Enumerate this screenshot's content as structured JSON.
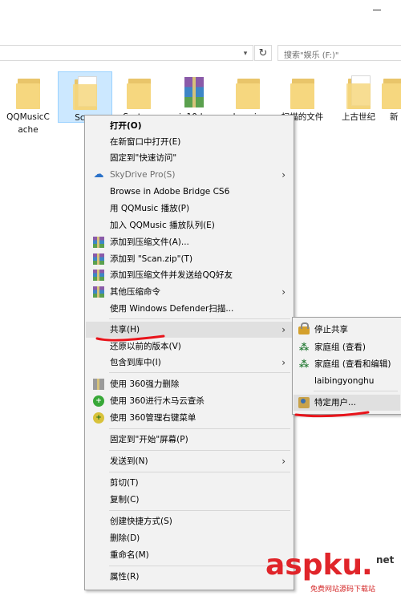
{
  "toolbar": {
    "refresh_icon": "↻",
    "search_placeholder": "搜索\"娱乐 (F:)\""
  },
  "files": [
    {
      "name": "QQMusicC ache",
      "icon": "folder"
    },
    {
      "name": "Scan",
      "icon": "folder-doc",
      "selected": true
    },
    {
      "name": "System",
      "icon": "folder"
    },
    {
      "name": "win10dow",
      "icon": "zip"
    },
    {
      "name": "zhaopian",
      "icon": "folder"
    },
    {
      "name": "扫描的文件",
      "icon": "folder"
    },
    {
      "name": "上古世纪",
      "icon": "folder-doc"
    },
    {
      "name": "新",
      "icon": "folder"
    }
  ],
  "context_menu": {
    "items": [
      {
        "label": "打开(O)",
        "bold": true
      },
      {
        "label": "在新窗口中打开(E)"
      },
      {
        "label": "固定到\"快速访问\""
      },
      {
        "label": "SkyDrive Pro(S)",
        "icon": "skydrive-icon",
        "disabled": true,
        "submenu": true
      },
      {
        "label": "Browse in Adobe Bridge CS6"
      },
      {
        "label": "用 QQMusic 播放(P)"
      },
      {
        "label": "加入 QQMusic 播放队列(E)"
      },
      {
        "label": "添加到压缩文件(A)...",
        "icon": "winrar-icon"
      },
      {
        "label": "添加到 \"Scan.zip\"(T)",
        "icon": "winrar-icon"
      },
      {
        "label": "添加到压缩文件并发送给QQ好友",
        "icon": "winrar-icon"
      },
      {
        "label": "其他压缩命令",
        "icon": "winrar-icon",
        "submenu": true
      },
      {
        "label": "使用 Windows Defender扫描..."
      },
      {
        "label": "共享(H)",
        "submenu": true,
        "highlighted": true
      },
      {
        "label": "还原以前的版本(V)"
      },
      {
        "label": "包含到库中(I)",
        "submenu": true
      },
      {
        "label": "使用 360强力删除",
        "icon": "shred-icon"
      },
      {
        "label": "使用 360进行木马云查杀",
        "icon": "360-scan-icon"
      },
      {
        "label": "使用 360管理右键菜单",
        "icon": "360-scan-icon"
      },
      {
        "label": "固定到\"开始\"屏幕(P)"
      },
      {
        "label": "发送到(N)",
        "submenu": true
      },
      {
        "label": "剪切(T)"
      },
      {
        "label": "复制(C)"
      },
      {
        "label": "创建快捷方式(S)"
      },
      {
        "label": "删除(D)"
      },
      {
        "label": "重命名(M)"
      },
      {
        "label": "属性(R)"
      }
    ]
  },
  "share_submenu": {
    "items": [
      {
        "label": "停止共享",
        "icon": "lock-icon"
      },
      {
        "label": "家庭组 (查看)",
        "icon": "homegroup-icon"
      },
      {
        "label": "家庭组 (查看和编辑)",
        "icon": "homegroup-icon"
      },
      {
        "label": "laibingyonghu"
      },
      {
        "label": "特定用户...",
        "icon": "users-icon",
        "highlighted": true
      }
    ]
  },
  "watermark": {
    "brand": "aspku",
    "dot": ".",
    "tld": "net",
    "subtitle": "免费网站源码下载站"
  },
  "colors": {
    "menu_bg": "#f2f2f2",
    "menu_hover": "#e0e0e0",
    "selection": "#cce8ff",
    "annotation": "#e8141b",
    "watermark": "#e0252a"
  }
}
